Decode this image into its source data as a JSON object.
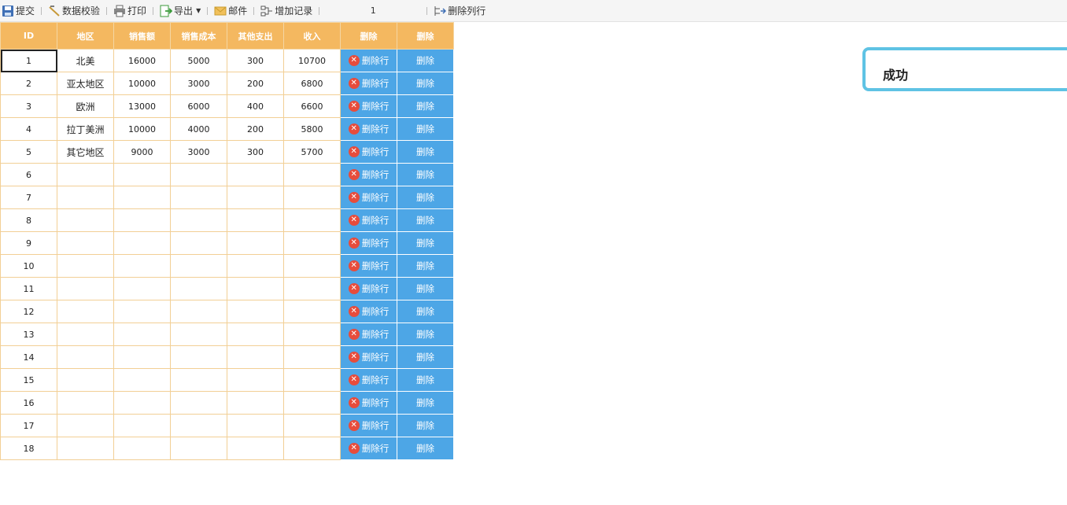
{
  "toolbar": {
    "submit": "提交",
    "validate": "数据校验",
    "print": "打印",
    "export": "导出",
    "mail": "邮件",
    "add_record": "增加记录",
    "page_number": "1",
    "delete_column": "删除列行"
  },
  "table": {
    "headers": [
      "ID",
      "地区",
      "销售额",
      "销售成本",
      "其他支出",
      "收入",
      "删除",
      "删除"
    ],
    "delete_row_label": "删除行",
    "delete_label": "删除",
    "rows": [
      {
        "id": "1",
        "region": "北美",
        "sales": "16000",
        "cost": "5000",
        "other": "300",
        "income": "10700"
      },
      {
        "id": "2",
        "region": "亚太地区",
        "sales": "10000",
        "cost": "3000",
        "other": "200",
        "income": "6800"
      },
      {
        "id": "3",
        "region": "欧洲",
        "sales": "13000",
        "cost": "6000",
        "other": "400",
        "income": "6600"
      },
      {
        "id": "4",
        "region": "拉丁美洲",
        "sales": "10000",
        "cost": "4000",
        "other": "200",
        "income": "5800"
      },
      {
        "id": "5",
        "region": "其它地区",
        "sales": "9000",
        "cost": "3000",
        "other": "300",
        "income": "5700"
      },
      {
        "id": "6",
        "region": "",
        "sales": "",
        "cost": "",
        "other": "",
        "income": ""
      },
      {
        "id": "7",
        "region": "",
        "sales": "",
        "cost": "",
        "other": "",
        "income": ""
      },
      {
        "id": "8",
        "region": "",
        "sales": "",
        "cost": "",
        "other": "",
        "income": ""
      },
      {
        "id": "9",
        "region": "",
        "sales": "",
        "cost": "",
        "other": "",
        "income": ""
      },
      {
        "id": "10",
        "region": "",
        "sales": "",
        "cost": "",
        "other": "",
        "income": ""
      },
      {
        "id": "11",
        "region": "",
        "sales": "",
        "cost": "",
        "other": "",
        "income": ""
      },
      {
        "id": "12",
        "region": "",
        "sales": "",
        "cost": "",
        "other": "",
        "income": ""
      },
      {
        "id": "13",
        "region": "",
        "sales": "",
        "cost": "",
        "other": "",
        "income": ""
      },
      {
        "id": "14",
        "region": "",
        "sales": "",
        "cost": "",
        "other": "",
        "income": ""
      },
      {
        "id": "15",
        "region": "",
        "sales": "",
        "cost": "",
        "other": "",
        "income": ""
      },
      {
        "id": "16",
        "region": "",
        "sales": "",
        "cost": "",
        "other": "",
        "income": ""
      },
      {
        "id": "17",
        "region": "",
        "sales": "",
        "cost": "",
        "other": "",
        "income": ""
      },
      {
        "id": "18",
        "region": "",
        "sales": "",
        "cost": "",
        "other": "",
        "income": ""
      }
    ]
  },
  "toast": {
    "message": "成功"
  },
  "colors": {
    "header_bg": "#f4b860",
    "button_bg": "#4da6e6",
    "toast_border": "#5fc3e4",
    "delete_icon": "#e74c3c"
  }
}
